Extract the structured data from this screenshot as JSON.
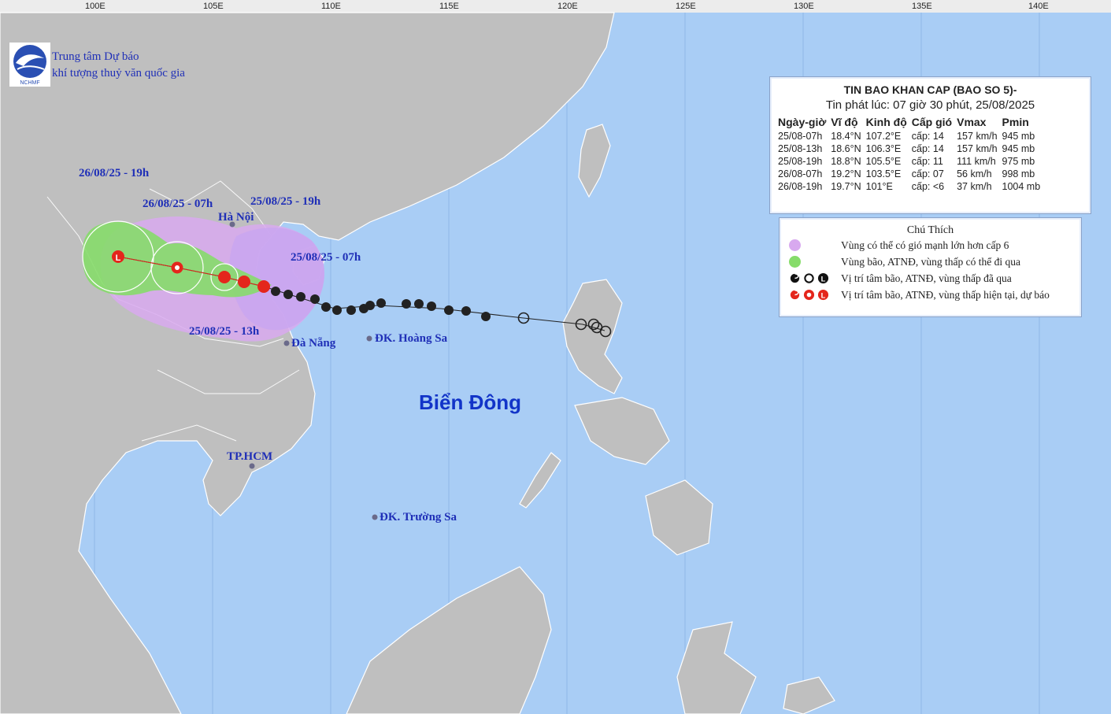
{
  "org": {
    "line1": "Trung tâm Dự báo",
    "line2": "khí tượng thuỷ văn quốc gia",
    "logo_text": "NCHMF"
  },
  "longitude_ticks": [
    "100E",
    "105E",
    "110E",
    "115E",
    "120E",
    "125E",
    "130E",
    "135E",
    "140E"
  ],
  "bulletin": {
    "title": "TIN BAO KHAN CAP (BAO SO 5)-",
    "issued": "Tin phát lúc: 07 giờ 30 phút, 25/08/2025",
    "headers": [
      "Ngày-giờ",
      "Vĩ độ",
      "Kinh độ",
      "Cấp gió",
      "Vmax",
      "Pmin"
    ],
    "rows": [
      [
        "25/08-07h",
        "18.4°N",
        "107.2°E",
        "cấp: 14",
        "157 km/h",
        "945 mb"
      ],
      [
        "25/08-13h",
        "18.6°N",
        "106.3°E",
        "cấp: 14",
        "157 km/h",
        "945 mb"
      ],
      [
        "25/08-19h",
        "18.8°N",
        "105.5°E",
        "cấp: 11",
        "111 km/h",
        "975 mb"
      ],
      [
        "26/08-07h",
        "19.2°N",
        "103.5°E",
        "cấp: 07",
        "56 km/h",
        "998 mb"
      ],
      [
        "26/08-19h",
        "19.7°N",
        "101°E",
        "cấp: <6",
        "37 km/h",
        "1004 mb"
      ]
    ]
  },
  "legend": {
    "title": "Chú Thích",
    "items": [
      "Vùng có thể có gió mạnh lớn hơn cấp 6",
      "Vùng bão, ATNĐ, vùng thấp có thể đi qua",
      "Vị trí tâm bão, ATNĐ, vùng thấp đã qua",
      "Vị trí tâm bão, ATNĐ, vùng thấp hiện tại, dự báo"
    ],
    "colors": {
      "strong_wind": "#d8a9ef",
      "danger_zone": "#86dc6a",
      "past": "#111111",
      "forecast": "#e4261c"
    }
  },
  "labels": {
    "t_2608_19h": "26/08/25 - 19h",
    "t_2608_07h": "26/08/25 - 07h",
    "t_2508_19h": "25/08/25 - 19h",
    "t_2508_07h": "25/08/25 - 07h",
    "t_2508_13h": "25/08/25 - 13h",
    "hanoi": "Hà Nội",
    "danang": "Đà Nẵng",
    "hoangsa": "ĐK. Hoàng Sa",
    "hcm": "TP.HCM",
    "truongsa": "ĐK. Trường Sa",
    "sea": "Biển Đông"
  },
  "colors": {
    "sea": "#a9cdf5",
    "land": "#bfbfbf",
    "track": "#222222"
  }
}
